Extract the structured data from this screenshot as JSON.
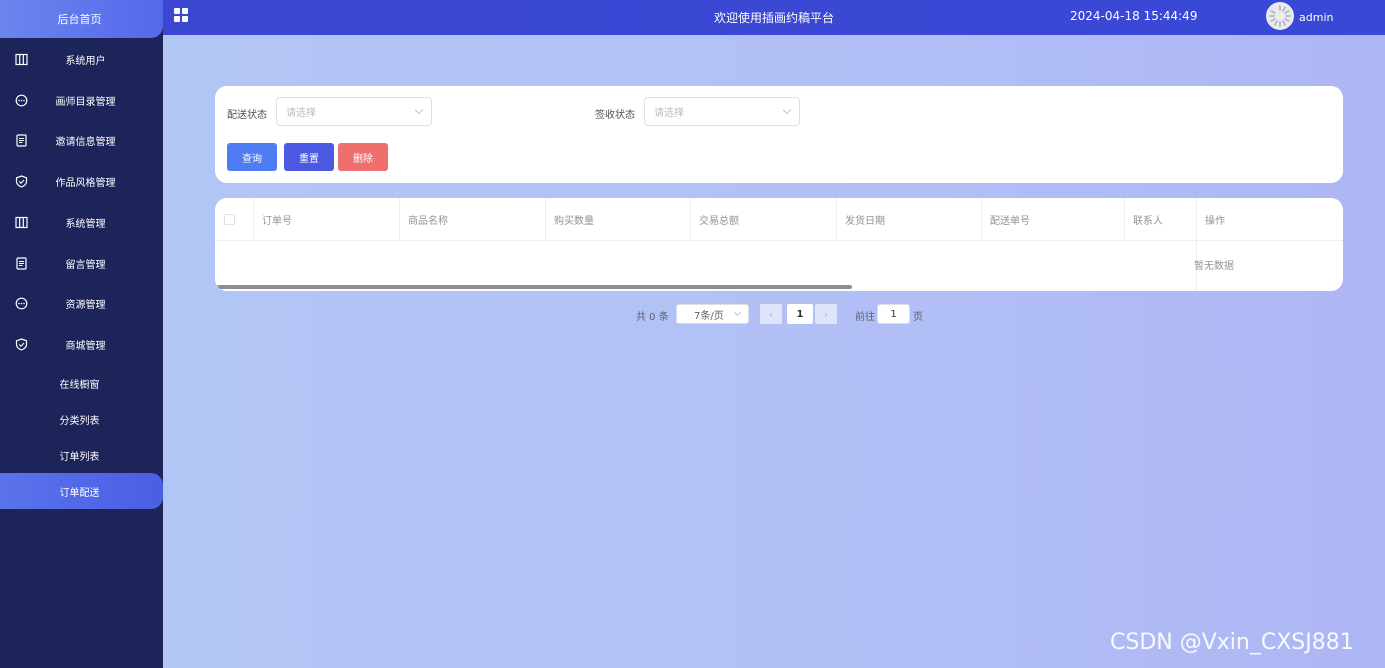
{
  "sidebar": {
    "home": "后台首页",
    "items": [
      {
        "label": "系统用户",
        "icon": "columns-icon"
      },
      {
        "label": "画师目录管理",
        "icon": "chat-bubble-icon"
      },
      {
        "label": "邀请信息管理",
        "icon": "document-icon"
      },
      {
        "label": "作品风格管理",
        "icon": "shield-check-icon"
      },
      {
        "label": "系统管理",
        "icon": "columns-icon"
      },
      {
        "label": "留言管理",
        "icon": "document-icon"
      },
      {
        "label": "资源管理",
        "icon": "chat-bubble-icon"
      },
      {
        "label": "商城管理",
        "icon": "shield-check-icon"
      }
    ],
    "subitems": [
      "在线橱窗",
      "分类列表",
      "订单列表",
      "订单配送"
    ]
  },
  "header": {
    "title": "欢迎使用插画约稿平台",
    "time": "2024-04-18 15:44:49",
    "user": "admin"
  },
  "search": {
    "delivery_status_label": "配送状态",
    "delivery_status_placeholder": "请选择",
    "sign_status_label": "签收状态",
    "sign_status_placeholder": "请选择",
    "query_button": "查询",
    "reset_button": "重置",
    "delete_button": "删除"
  },
  "table": {
    "columns": [
      "订单号",
      "商品名称",
      "购买数量",
      "交易总额",
      "发货日期",
      "配送单号",
      "联系人",
      "操作"
    ],
    "empty_text": "暂无数据"
  },
  "pagination": {
    "total": "共 0 条",
    "page_size": "7条/页",
    "current_page": "1",
    "goto_label": "前往",
    "goto_value": "1",
    "page_suffix": "页"
  },
  "watermark": "CSDN @Vxin_CXSJ881",
  "colors": {
    "sidebar_bg": "#1d2459",
    "header_bg": "#3b47d2",
    "query_button": "#4f7cf2",
    "reset_button": "#4c59e3",
    "delete_button": "#ef6f6f"
  }
}
